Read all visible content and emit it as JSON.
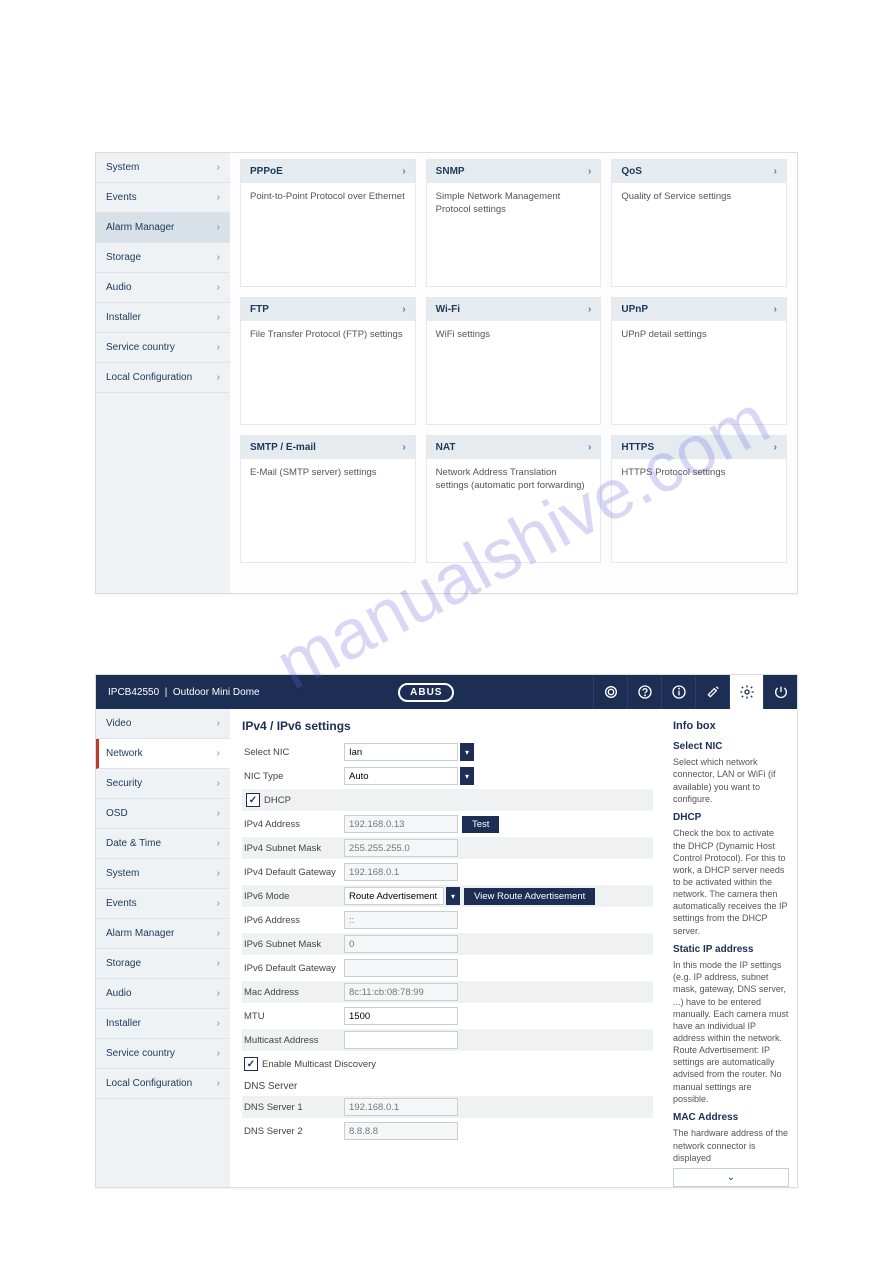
{
  "watermark": "manualshive.com",
  "panel1": {
    "sidebar": [
      {
        "label": "System",
        "selected": false
      },
      {
        "label": "Events",
        "selected": false
      },
      {
        "label": "Alarm Manager",
        "selected": true
      },
      {
        "label": "Storage",
        "selected": false
      },
      {
        "label": "Audio",
        "selected": false
      },
      {
        "label": "Installer",
        "selected": false
      },
      {
        "label": "Service country",
        "selected": false
      },
      {
        "label": "Local Configuration",
        "selected": false
      }
    ],
    "cards": [
      [
        {
          "title": "PPPoE",
          "desc": "Point-to-Point Protocol over Ethernet"
        },
        {
          "title": "SNMP",
          "desc": "Simple Network Management Protocol settings"
        },
        {
          "title": "QoS",
          "desc": "Quality of Service settings"
        }
      ],
      [
        {
          "title": "FTP",
          "desc": "File Transfer Protocol (FTP) settings"
        },
        {
          "title": "Wi-Fi",
          "desc": "WiFi settings"
        },
        {
          "title": "UPnP",
          "desc": "UPnP detail settings"
        }
      ],
      [
        {
          "title": "SMTP / E-mail",
          "desc": "E-Mail (SMTP server) settings"
        },
        {
          "title": "NAT",
          "desc": "Network Address Translation settings (automatic port forwarding)"
        },
        {
          "title": "HTTPS",
          "desc": "HTTPS Protocol settings"
        }
      ]
    ]
  },
  "panel2": {
    "topbar": {
      "device": "IPCB42550",
      "separator": "|",
      "device_name": "Outdoor Mini Dome",
      "logo": "ABUS"
    },
    "sidebar": [
      {
        "label": "Video",
        "selected": false
      },
      {
        "label": "Network",
        "selected": true
      },
      {
        "label": "Security",
        "selected": false
      },
      {
        "label": "OSD",
        "selected": false
      },
      {
        "label": "Date & Time",
        "selected": false
      },
      {
        "label": "System",
        "selected": false
      },
      {
        "label": "Events",
        "selected": false
      },
      {
        "label": "Alarm Manager",
        "selected": false
      },
      {
        "label": "Storage",
        "selected": false
      },
      {
        "label": "Audio",
        "selected": false
      },
      {
        "label": "Installer",
        "selected": false
      },
      {
        "label": "Service country",
        "selected": false
      },
      {
        "label": "Local Configuration",
        "selected": false
      }
    ],
    "form": {
      "title": "IPv4 / IPv6 settings",
      "select_nic": {
        "label": "Select NIC",
        "value": "Ian"
      },
      "nic_type": {
        "label": "NIC Type",
        "value": "Auto"
      },
      "dhcp": {
        "label": "DHCP",
        "checked": true
      },
      "ipv4_addr": {
        "label": "IPv4 Address",
        "value": "192.168.0.13",
        "btn": "Test"
      },
      "ipv4_mask": {
        "label": "IPv4 Subnet Mask",
        "value": "255.255.255.0"
      },
      "ipv4_gw": {
        "label": "IPv4 Default Gateway",
        "value": "192.168.0.1"
      },
      "ipv6_mode": {
        "label": "IPv6 Mode",
        "value": "Route Advertisement",
        "btn": "View Route Advertisement"
      },
      "ipv6_addr": {
        "label": "IPv6 Address",
        "value": "::"
      },
      "ipv6_mask": {
        "label": "IPv6 Subnet Mask",
        "value": "0"
      },
      "ipv6_gw": {
        "label": "IPv6 Default Gateway",
        "value": ""
      },
      "mac": {
        "label": "Mac Address",
        "value": "8c:11:cb:08:78:99"
      },
      "mtu": {
        "label": "MTU",
        "value": "1500"
      },
      "multicast": {
        "label": "Multicast Address",
        "value": ""
      },
      "mc_disc": {
        "label": "Enable Multicast Discovery",
        "checked": true
      },
      "dns_section": {
        "label": "DNS Server"
      },
      "dns1": {
        "label": "DNS Server 1",
        "value": "192.168.0.1"
      },
      "dns2": {
        "label": "DNS Server 2",
        "value": "8.8.8.8"
      }
    },
    "infobox": {
      "title": "Info box",
      "sections": [
        {
          "head": "Select NIC",
          "text": "Select which network connector, LAN or WiFi (if available) you want to configure."
        },
        {
          "head": "DHCP",
          "text": "Check the box to activate the DHCP (Dynamic Host Control Protocol). For this to work, a DHCP server needs to be activated within the network. The camera then automatically receives the IP settings from the DHCP server."
        },
        {
          "head": "Static IP address",
          "text": "In this mode the IP settings (e.g. IP address, subnet mask, gateway, DNS server, ...) have to be entered manually. Each camera must have an individual IP address within the network. Route Advertisement: IP settings are automatically advised from the router. No manual settings are possible."
        },
        {
          "head": "MAC Address",
          "text": "The hardware address of the network connector is displayed"
        }
      ],
      "expand": "⌄"
    }
  }
}
